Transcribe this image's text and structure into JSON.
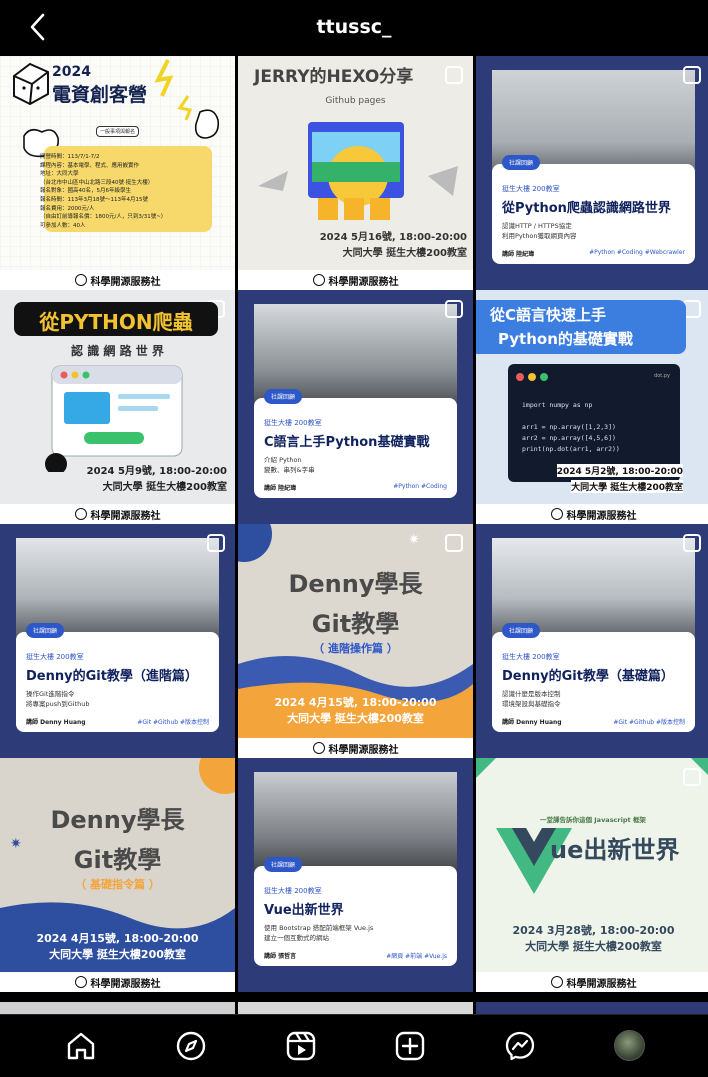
{
  "header": {
    "title": "ttussc_"
  },
  "footer_label": "科學開源服務社",
  "tiles": {
    "t1": {
      "year": "2024",
      "title": "電資創客營",
      "small_note": "一般事項與報名",
      "lines": [
        "開營時間：113/7/1-7/2",
        "課程內容：基本電學、程式、應用嵌實作",
        "地址：大同大學",
        "（台北市中山區中山北路三段40號·挺生大樓）",
        "報名對象：國高40名，5月6年級學生",
        "報名時間：113年3月18號～113年4月15號",
        "報名費用：2000元/人",
        "（自由訂前導報名價：1800元/人，只到3/31號~）",
        "可參加人數：40人"
      ]
    },
    "t2": {
      "title": "JERRY的HEXO分享",
      "subtitle": "Github pages",
      "date": "2024 5月16號, 18:00-20:00",
      "place": "大同大學 挺生大樓200教室"
    },
    "t3": {
      "tag": "社課回顧",
      "sub": "挺生大樓 200教室",
      "title": "從Python爬蟲認識網路世界",
      "desc1": "認識HTTP / HTTPS協定",
      "desc2": "利用Python獲取網頁內容",
      "speaker": "講師 陸紀瑋",
      "tags": "#Python #Coding #Webcrawler"
    },
    "t4": {
      "title": "從PYTHON爬蟲",
      "subtitle": "認 識 網 路 世 界",
      "date": "2024 5月9號, 18:00-20:00",
      "place": "大同大學 挺生大樓200教室"
    },
    "t5": {
      "tag": "社課回顧",
      "sub": "挺生大樓 200教室",
      "title": "C語言上手Python基礎實戰",
      "desc1": "介紹 Python",
      "desc2": "變數、串列&字串",
      "speaker": "講師 陸紀瑋",
      "tags": "#Python #Coding"
    },
    "t6": {
      "title1": "從C語言快速上手",
      "title2": "Python的基礎實戰",
      "filename": "dot.py",
      "code": [
        "import numpy as np",
        "",
        "arr1 = np.array([1,2,3])",
        "arr2 = np.array([4,5,6])",
        "print(np.dot(arr1, arr2))"
      ],
      "date": "2024 5月2號, 18:00-20:00",
      "place": "大同大學 挺生大樓200教室"
    },
    "t7": {
      "tag": "社課回顧",
      "sub": "挺生大樓 200教室",
      "title": "Denny的Git教學（進階篇）",
      "desc1": "操作Git進階指令",
      "desc2": "將專案push到Github",
      "speaker": "講師 Denny Huang",
      "tags": "#Git #Github #版本控制"
    },
    "t8": {
      "title1": "Denny學長",
      "title2": "Git教學",
      "subtitle": "（ 進階操作篇 ）",
      "date": "2024 4月15號, 18:00-20:00",
      "place": "大同大學 挺生大樓200教室"
    },
    "t9": {
      "tag": "社課回顧",
      "sub": "挺生大樓 200教室",
      "title": "Denny的Git教學（基礎篇）",
      "desc1": "認識什麼是版本控制",
      "desc2": "環境架設與基礎指令",
      "speaker": "講師 Denny Huang",
      "tags": "#Git #Github #版本控制"
    },
    "t10": {
      "title1": "Denny學長",
      "title2": "Git教學",
      "subtitle": "（ 基礎指令篇 ）",
      "date": "2024 4月15號, 18:00-20:00",
      "place": "大同大學 挺生大樓200教室"
    },
    "t11": {
      "tag": "社課回顧",
      "sub": "挺生大樓 200教室",
      "title": "Vue出新世界",
      "desc1": "使用 Bootstrap 搭配前端框架 Vue.js",
      "desc2": "建立一個互動式的網站",
      "speaker": "講師 張哲言",
      "tags": "#網頁 #前端 #Vue.js"
    },
    "t12": {
      "banner": "一堂課告訴你這個 Javascript 框架",
      "title": "ue出新世界",
      "date": "2024 3月28號, 18:00-20:00",
      "place": "大同大學 挺生大樓200教室"
    }
  },
  "colors": {
    "background": "#000000",
    "card_blue": "#2e57c8",
    "navy": "#10225e",
    "vue_green": "#42b883"
  }
}
